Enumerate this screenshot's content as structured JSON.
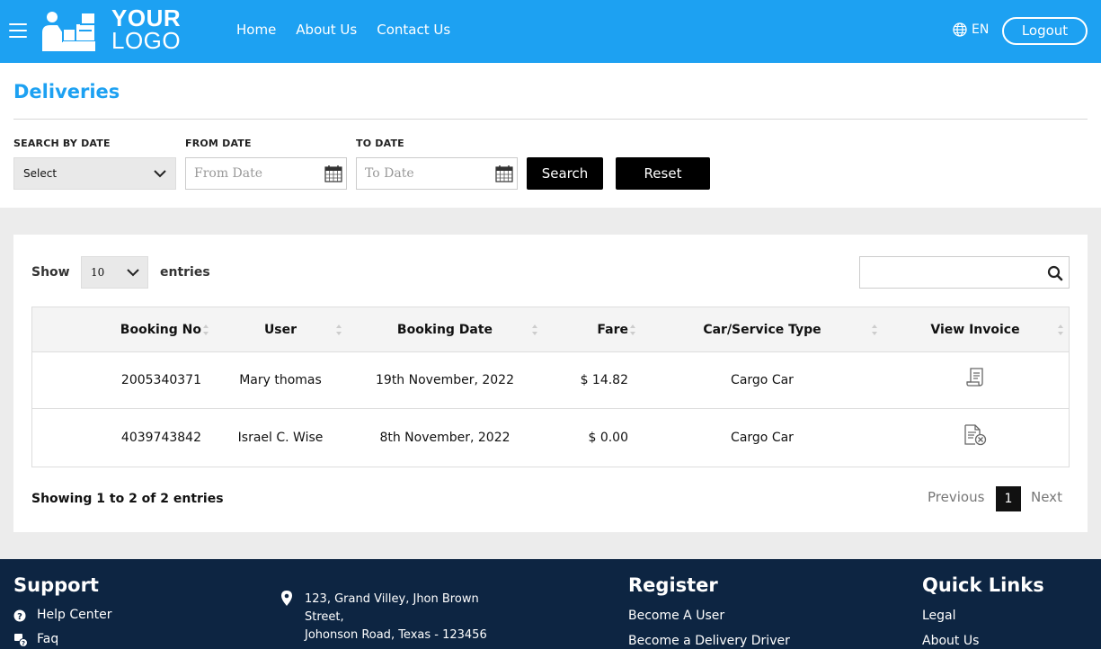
{
  "header": {
    "logo_line1": "YOUR",
    "logo_line2": "LOGO",
    "nav": [
      "Home",
      "About Us",
      "Contact Us"
    ],
    "language": "EN",
    "logout_label": "Logout",
    "color": "#1da1f2"
  },
  "filters": {
    "page_title": "Deliveries",
    "search_by_date_label": "SEARCH BY DATE",
    "search_by_date_value": "Select",
    "from_date_label": "FROM DATE",
    "from_date_placeholder": "From Date",
    "to_date_label": "TO DATE",
    "to_date_placeholder": "To Date",
    "search_button": "Search",
    "reset_button": "Reset"
  },
  "table_controls": {
    "show_label": "Show",
    "entries_value": "10",
    "entries_label": "entries"
  },
  "table": {
    "columns": [
      "Booking No",
      "User",
      "Booking Date",
      "Fare",
      "Car/Service Type",
      "View Invoice"
    ],
    "rows": [
      {
        "booking_no": "2005340371",
        "user": "Mary thomas",
        "date": "19th November, 2022",
        "fare": "$ 14.82",
        "type": "Cargo Car",
        "invoice_icon": "receipt-icon"
      },
      {
        "booking_no": "4039743842",
        "user": "Israel C. Wise",
        "date": "8th November, 2022",
        "fare": "$ 0.00",
        "type": "Cargo Car",
        "invoice_icon": "invoice-cancelled-icon"
      }
    ]
  },
  "pagination": {
    "summary": "Showing 1 to 2 of 2 entries",
    "previous": "Previous",
    "current": "1",
    "next": "Next"
  },
  "footer": {
    "support_heading": "Support",
    "support_links": [
      "Help Center",
      "Faq"
    ],
    "address_lines": [
      "123, Grand Villey, Jhon Brown",
      "Street,",
      "Johonson Road, Texas - 123456"
    ],
    "register_heading": "Register",
    "register_links": [
      "Become A User",
      "Become a Delivery Driver"
    ],
    "quick_heading": "Quick Links",
    "quick_links": [
      "Legal",
      "About Us"
    ],
    "background": "#0d2542"
  }
}
